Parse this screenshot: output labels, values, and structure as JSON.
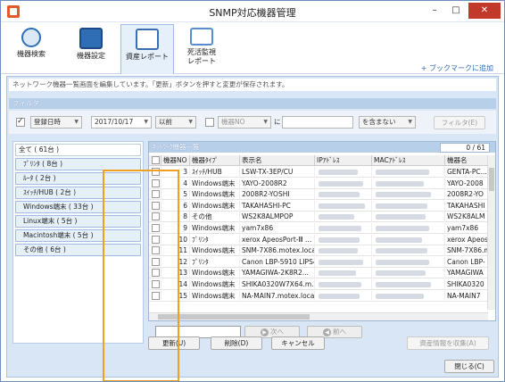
{
  "window": {
    "title": "SNMP対応機器管理",
    "minimize": "–",
    "maximize": "□",
    "close": "✕"
  },
  "ribbon": {
    "buttons": [
      {
        "label": "機器検索"
      },
      {
        "label": "機器設定"
      },
      {
        "label": "資産レポート"
      },
      {
        "label1": "死活監視",
        "label2": "レポート"
      }
    ],
    "bookmark": "+ ブックマークに追加"
  },
  "info_text": "ネットワーク機器一覧画面を編集しています。「更新」ボタンを押すと変更が保存されます。",
  "filter": {
    "header": "フィルタ",
    "field1": "登録日時",
    "date": "2017/10/17",
    "relation": "以前",
    "field2": "機器NO",
    "ni": "に",
    "condition": "を含まない",
    "filter_button": "フィルタ(E)"
  },
  "groups": {
    "all": "全て ( 61台 )",
    "items": [
      "ﾌﾟﾘﾝﾀ ( 8台 )",
      "ﾙｰﾀ ( 2台 )",
      "ｽｲｯﾁ/HUB ( 2台 )",
      "Windows端末 ( 33台 )",
      "Linux端末 ( 5台 )",
      "Macintosh端末 ( 5台 )",
      "その他 ( 6台 )"
    ]
  },
  "grid": {
    "header": "ﾈｯﾄﾜｰｸ機器一覧",
    "count": "0 / 61",
    "columns": [
      "機器NO",
      "機器ﾀｲﾌﾟ",
      "表示名",
      "IPｱﾄﾞﾚｽ",
      "MACｱﾄﾞﾚｽ",
      "機器名"
    ],
    "rows": [
      {
        "no": "3",
        "type": "ｽｲｯﾁ/HUB",
        "name": "LSW-TX-3EP/CU",
        "host": "GENTA-PC..."
      },
      {
        "no": "4",
        "type": "Windows端末",
        "name": "YAYO-2008R2",
        "host": "YAYO-2008"
      },
      {
        "no": "5",
        "type": "Windows端末",
        "name": "2008R2-YOSHI",
        "host": "2008R2-YO"
      },
      {
        "no": "6",
        "type": "Windows端末",
        "name": "TAKAHASHI-PC",
        "host": "TAKAHASHI"
      },
      {
        "no": "8",
        "type": "その他",
        "name": "WS2K8ALMPOP",
        "host": "WS2K8ALM"
      },
      {
        "no": "9",
        "type": "Windows端末",
        "name": "yam7x86",
        "host": "yam7x86"
      },
      {
        "no": "10",
        "type": "ﾌﾟﾘﾝﾀ",
        "name": "xerox ApeosPort-Ⅲ ...",
        "host": "xerox Apeos"
      },
      {
        "no": "11",
        "type": "Windows端末",
        "name": "SNM-7X86.motex.local",
        "host": "SNM-7X86.m"
      },
      {
        "no": "12",
        "type": "ﾌﾟﾘﾝﾀ",
        "name": "Canon LBP-5910 LIPS4",
        "host": "Canon LBP-"
      },
      {
        "no": "13",
        "type": "Windows端末",
        "name": "YAMAGIWA-2K8R2...",
        "host": "YAMAGIWA"
      },
      {
        "no": "14",
        "type": "Windows端末",
        "name": "SHIKA0320W7X64.m...",
        "host": "SHIKA0320"
      },
      {
        "no": "15",
        "type": "Windows端末",
        "name": "NA-MAIN7.motex.local",
        "host": "NA-MAIN7"
      }
    ]
  },
  "pager": {
    "next": "次へ",
    "prev": "前へ"
  },
  "actions": {
    "update": "更新(U)",
    "delete": "削除(D)",
    "cancel": "キャンセル",
    "collect": "資産情報を収集(A)",
    "close": "閉じる(C)"
  }
}
